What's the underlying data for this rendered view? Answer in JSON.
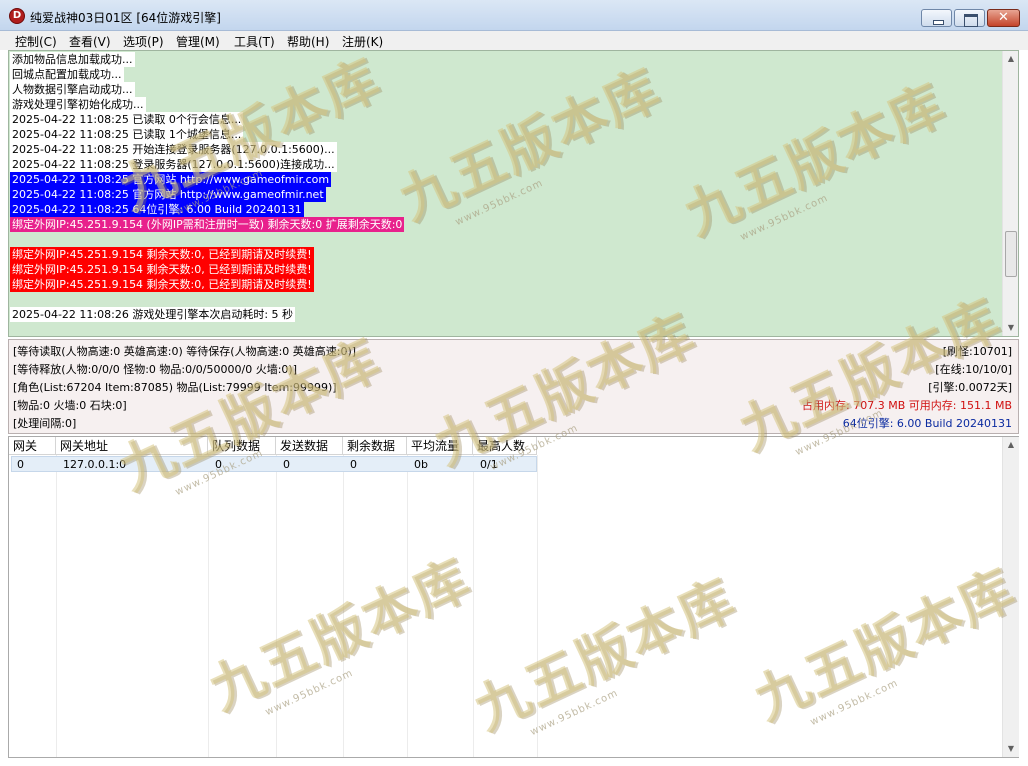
{
  "window": {
    "icon_letter": "D",
    "title": "纯爱战神03日01区 [64位游戏引擎]",
    "close_glyph": "✕"
  },
  "menu": [
    {
      "label": "控制(C)"
    },
    {
      "label": "查看(V)"
    },
    {
      "label": "选项(P)"
    },
    {
      "label": "管理(M)"
    },
    {
      "label": "工具(T)"
    },
    {
      "label": "帮助(H)"
    },
    {
      "label": "注册(K)"
    }
  ],
  "log": [
    {
      "text": "添加物品信息加载成功...",
      "style": "hl-white"
    },
    {
      "text": "回城点配置加载成功...",
      "style": "hl-white"
    },
    {
      "text": "人物数据引擎启动成功...",
      "style": "hl-white"
    },
    {
      "text": "游戏处理引擎初始化成功...",
      "style": "hl-white"
    },
    {
      "text": "2025-04-22 11:08:25 已读取 0个行会信息...",
      "style": "hl-white"
    },
    {
      "text": "2025-04-22 11:08:25 已读取 1个城堡信息...",
      "style": "hl-white"
    },
    {
      "text": "2025-04-22 11:08:25 开始连接登录服务器(127.0.0.1:5600)...",
      "style": "hl-white"
    },
    {
      "text": "2025-04-22 11:08:25 登录服务器(127.0.0.1:5600)连接成功...",
      "style": "hl-white"
    },
    {
      "text": "2025-04-22 11:08:25 官方网站 http://www.gameofmir.com",
      "style": "hl-blue"
    },
    {
      "text": "2025-04-22 11:08:25 官方网站 http://www.gameofmir.net",
      "style": "hl-blue"
    },
    {
      "text": "2025-04-22 11:08:25 64位引擎: 6.00 Build 20240131",
      "style": "hl-blue"
    },
    {
      "text": "绑定外网IP:45.251.9.154 (外网IP需和注册时一致) 剩余天数:0 扩展剩余天数:0",
      "style": "hl-magenta"
    },
    {
      "text": "",
      "style": "plain"
    },
    {
      "text": "绑定外网IP:45.251.9.154 剩余天数:0, 已经到期请及时续费!",
      "style": "hl-red"
    },
    {
      "text": "绑定外网IP:45.251.9.154 剩余天数:0, 已经到期请及时续费!",
      "style": "hl-red"
    },
    {
      "text": "绑定外网IP:45.251.9.154 剩余天数:0, 已经到期请及时续费!",
      "style": "hl-red"
    },
    {
      "text": "",
      "style": "plain"
    },
    {
      "text": "2025-04-22 11:08:26 游戏处理引擎本次启动耗时: 5 秒",
      "style": "hl-white"
    }
  ],
  "status": {
    "left": [
      "[等待读取(人物高速:0 英雄高速:0) 等待保存(人物高速:0 英雄高速:0)]",
      "[等待释放(人物:0/0/0 怪物:0 物品:0/0/50000/0 火墙:0)]",
      "[角色(List:67204 Item:87085) 物品(List:79999 Item:99999)]",
      "[物品:0 火墙:0 石块:0]",
      "[处理间隔:0]"
    ],
    "right": [
      "[刷怪:10701]",
      "[在线:10/10/0]",
      "[引擎:0.0072天]",
      "占用内存: 707.3 MB 可用内存: 151.1 MB",
      "64位引擎: 6.00 Build 20240131"
    ]
  },
  "grid": {
    "columns": [
      "网关",
      "网关地址",
      "队列数据",
      "发送数据",
      "剩余数据",
      "平均流量",
      "最高人数"
    ],
    "rows": [
      [
        "0",
        "127.0.0.1:0",
        "0",
        "0",
        "0",
        "0b",
        "0/1"
      ]
    ]
  },
  "watermark": {
    "text": "九五版本库",
    "url": "www.95bbk.com"
  },
  "colors": {
    "log_bg": "#cfe8cf",
    "hl_blue": "#0000ff",
    "hl_magenta": "#e8218c",
    "hl_red": "#ff0000",
    "memory_text": "#d01010",
    "engine_text": "#0a2aa0"
  },
  "icons": [
    "app-logo-icon",
    "minimize-icon",
    "maximize-icon",
    "close-icon",
    "scroll-up-icon",
    "scroll-down-icon"
  ]
}
